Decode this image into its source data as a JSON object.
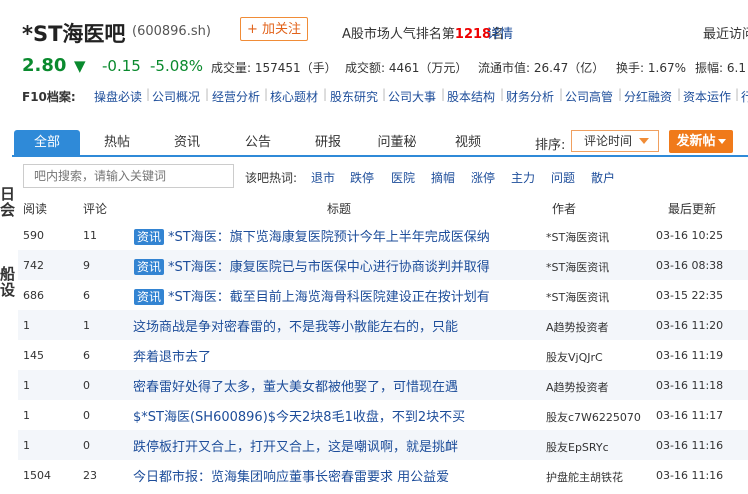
{
  "header": {
    "title": "*ST海医吧",
    "code": "(600896.sh)",
    "follow": "+ 加关注",
    "rank_prefix": "A股市场人气排名第",
    "rank_num": "1218",
    "rank_suffix": "名",
    "detail": "详情",
    "recent": "最近访问"
  },
  "quote": {
    "price": "2.80",
    "arrow": "▼",
    "change": "-0.15",
    "change_pct": "-5.08%",
    "volume_label": "成交量:",
    "volume": "157451（手）",
    "amount_label": "成交额:",
    "amount": "4461（万元）",
    "mktcap_label": "流通市值:",
    "mktcap": "26.47（亿）",
    "turnover_label": "换手:",
    "turnover": "1.67%",
    "amplitude_label": "振幅:",
    "amplitude": "6.1"
  },
  "f10": {
    "label": "F10档案:",
    "items": [
      "操盘必读",
      "公司概况",
      "经营分析",
      "核心题材",
      "股东研究",
      "公司大事",
      "股本结构",
      "财务分析",
      "公司高管",
      "分红融资",
      "资本运作",
      "行"
    ]
  },
  "left_strip": [
    "日",
    "会",
    "船",
    "设"
  ],
  "tabs": [
    "全部",
    "热帖",
    "资讯",
    "公告",
    "研报",
    "问董秘",
    "视频"
  ],
  "sort": {
    "label": "排序:",
    "value": "评论时间"
  },
  "post_button": "发新帖",
  "search": {
    "placeholder": "吧内搜索，请输入关键词"
  },
  "hot": {
    "label": "该吧热词:",
    "words": [
      "退市",
      "跌停",
      "医院",
      "摘帽",
      "涨停",
      "主力",
      "问题",
      "散户"
    ]
  },
  "columns": [
    "阅读",
    "评论",
    "标题",
    "作者",
    "最后更新"
  ],
  "rows": [
    {
      "read": "590",
      "comments": "11",
      "tag": "资讯",
      "title": "*ST海医：旗下览海康复医院预计今年上半年完成医保纳",
      "author": "*ST海医资讯",
      "time": "03-16 10:25"
    },
    {
      "read": "742",
      "comments": "9",
      "tag": "资讯",
      "title": "*ST海医：康复医院已与市医保中心进行协商谈判并取得",
      "author": "*ST海医资讯",
      "time": "03-16 08:38"
    },
    {
      "read": "686",
      "comments": "6",
      "tag": "资讯",
      "title": "*ST海医：截至目前上海览海骨科医院建设正在按计划有",
      "author": "*ST海医资讯",
      "time": "03-15 22:35"
    },
    {
      "read": "1",
      "comments": "1",
      "tag": "",
      "title": "这场商战是争对密春雷的，不是我等小散能左右的，只能",
      "author": "A趋势投资者",
      "time": "03-16 11:20"
    },
    {
      "read": "145",
      "comments": "6",
      "tag": "",
      "title": "奔着退市去了",
      "author": "股友VjQJrC",
      "time": "03-16 11:19"
    },
    {
      "read": "1",
      "comments": "0",
      "tag": "",
      "title": "密春雷好处得了太多，董大美女都被他娶了，可惜现在遇",
      "author": "A趋势投资者",
      "time": "03-16 11:18"
    },
    {
      "read": "1",
      "comments": "0",
      "tag": "",
      "title": "$*ST海医(SH600896)$今天2块8毛1收盘，不到2块不买",
      "author": "股友c7W6225070",
      "time": "03-16 11:17"
    },
    {
      "read": "1",
      "comments": "0",
      "tag": "",
      "title": "跌停板打开又合上，打开又合上，这是嘲讽啊，就是挑衅",
      "author": "股友EpSRYc",
      "time": "03-16 11:16"
    },
    {
      "read": "1504",
      "comments": "23",
      "tag": "",
      "title": "今日都市报：览海集团响应董事长密春雷要求 用公益爱",
      "author": "护盘舵主胡铁花",
      "time": "03-16 11:16"
    }
  ]
}
